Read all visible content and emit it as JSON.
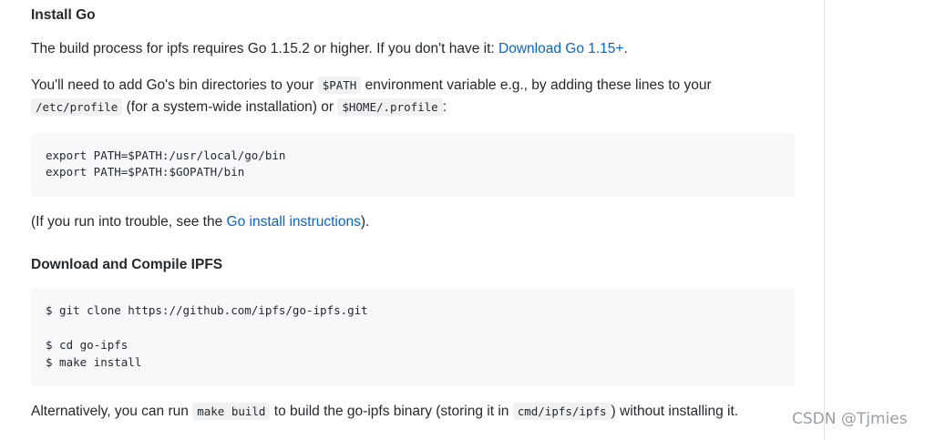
{
  "install_go": {
    "heading": "Install Go",
    "req_text": "The build process for ipfs requires Go 1.15.2 or higher. If you don't have it: ",
    "req_link": "Download Go 1.15+",
    "req_end": ".",
    "path_text_1": "You'll need to add Go's bin directories to your ",
    "path_code": "$PATH",
    "path_text_2": " environment variable e.g., by adding these lines to your",
    "profile_code": "/etc/profile",
    "path_text_3": " (for a system-wide installation) or ",
    "home_profile_code": "$HOME/.profile",
    "path_text_4": ":",
    "code_lines": [
      "export PATH=$PATH:/usr/local/go/bin",
      "export PATH=$PATH:$GOPATH/bin"
    ],
    "trouble_text_1": "(If you run into trouble, see the ",
    "trouble_link": "Go install instructions",
    "trouble_text_2": ")."
  },
  "compile": {
    "heading": "Download and Compile IPFS",
    "code_lines": [
      "$ git clone https://github.com/ipfs/go-ipfs.git",
      "",
      "$ cd go-ipfs",
      "$ make install"
    ],
    "alt_text_1": "Alternatively, you can run ",
    "alt_code_1": "make build",
    "alt_text_2": " to build the go-ipfs binary (storing it in ",
    "alt_code_2": "cmd/ipfs/ipfs",
    "alt_text_3": ") without installing it."
  },
  "watermark": "CSDN @Tjmies"
}
